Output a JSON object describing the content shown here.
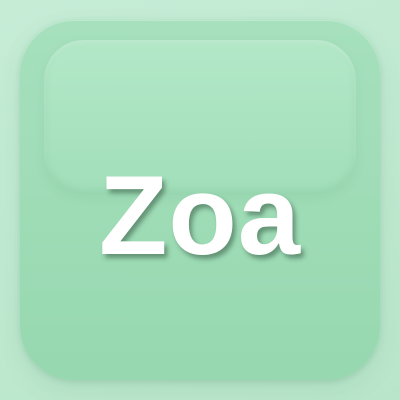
{
  "app_icon": {
    "label": "Zoa",
    "colors": {
      "background": "#c0e9d1",
      "tile": "#9fdcb7",
      "gloss": "#b6e8c9",
      "text": "#ffffff"
    }
  }
}
